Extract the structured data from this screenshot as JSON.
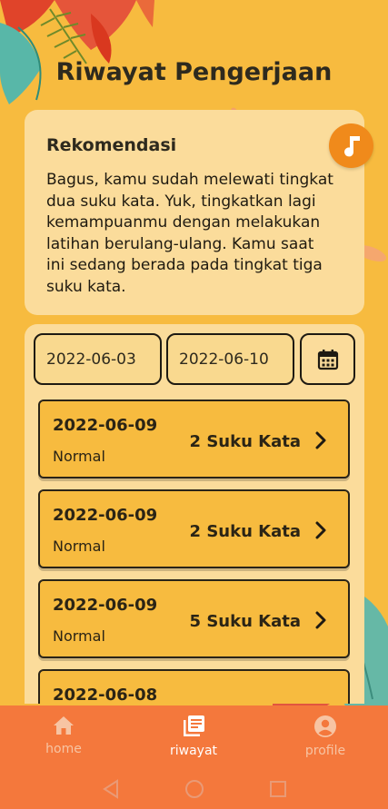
{
  "header": {
    "title": "Riwayat Pengerjaan"
  },
  "recommendation": {
    "title": "Rekomendasi",
    "lines": [
      "Bagus, kamu sudah melewati tingkat",
      "dua suku kata. Yuk, tingkatkan lagi",
      "kemampuanmu dengan melakukan",
      "latihan berulang-ulang. Kamu saat",
      "ini sedang berada pada tingkat tiga",
      "suku kata."
    ],
    "music_icon": "music-note-icon"
  },
  "filter": {
    "start_date": "2022-06-03",
    "end_date": "2022-06-10",
    "calendar_icon": "calendar-icon"
  },
  "records": [
    {
      "date": "2022-06-09",
      "mode": "Normal",
      "level": "2 Suku Kata"
    },
    {
      "date": "2022-06-09",
      "mode": "Normal",
      "level": "2 Suku Kata"
    },
    {
      "date": "2022-06-09",
      "mode": "Normal",
      "level": "5 Suku Kata"
    },
    {
      "date": "2022-06-08",
      "mode": "",
      "level": ""
    }
  ],
  "nav": {
    "items": [
      {
        "label": "home",
        "icon": "home-icon"
      },
      {
        "label": "riwayat",
        "icon": "history-icon",
        "active": true
      },
      {
        "label": "profile",
        "icon": "profile-icon"
      }
    ]
  },
  "colors": {
    "background": "#f7bb3f",
    "card": "#fbdc9b",
    "accent": "#f08a1b",
    "nav": "#f4783c"
  }
}
